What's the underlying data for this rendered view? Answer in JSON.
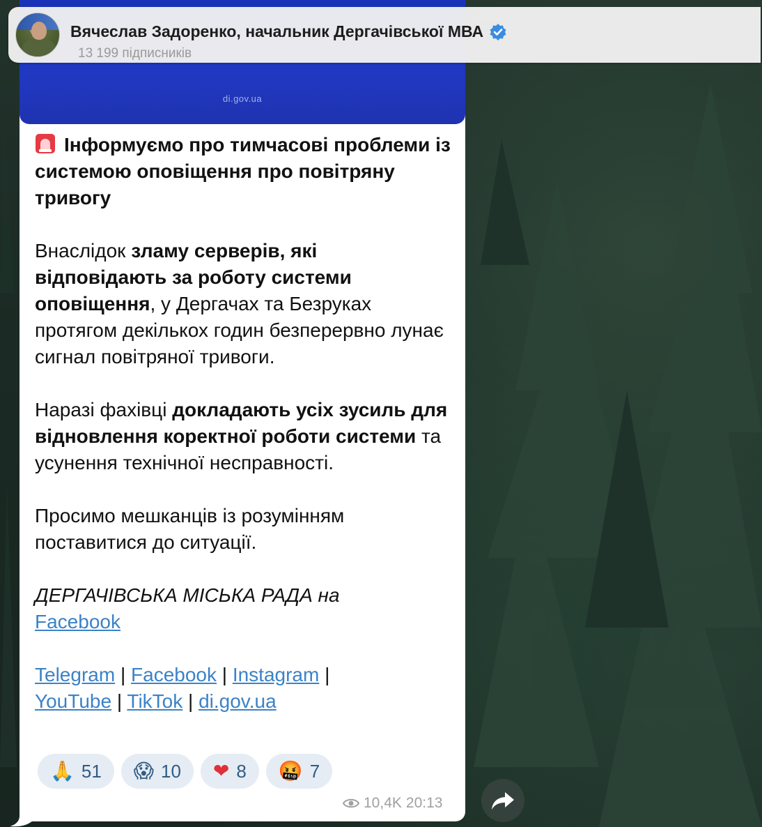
{
  "header": {
    "channel_name": "Вячеслав Задоренко, начальник Дергачівської МВА",
    "subscribers": "13 199 підписників",
    "verified_icon": "verified-badge-icon"
  },
  "media": {
    "site_label": "di.gov.ua"
  },
  "message": {
    "p1_bold": "Інформуємо про тимчасові проблеми із системою оповіщення про повітряну тривогу",
    "p2_a": "Внаслідок ",
    "p2_b": "зламу серверів, які відповідають за роботу системи оповіщення",
    "p2_c": ", у Дергачах та Безруках протягом декількох годин безперервно лунає сигнал повітряної тривоги.",
    "p3_a": "Наразі фахівці ",
    "p3_b": "докладають усіх зусиль для відновлення коректної роботи системи",
    "p3_c": " та усунення технічної несправності.",
    "p4": "Просимо мешканців із розумінням поставитися до ситуації.",
    "p5_italic": "ДЕРГАЧІВСЬКА МІСЬКА РАДА на",
    "p5_link": "Facebook",
    "links": [
      "Telegram",
      "Facebook",
      "Instagram",
      "YouTube",
      "TikTok",
      "di.gov.ua"
    ],
    "separator": "|"
  },
  "reactions": [
    {
      "emoji": "🙏",
      "count": "51"
    },
    {
      "emoji": "😱",
      "count": "10"
    },
    {
      "emoji": "❤",
      "count": "8"
    },
    {
      "emoji": "🤬",
      "count": "7"
    }
  ],
  "meta": {
    "views": "10,4K",
    "time": "20:13"
  },
  "colors": {
    "link": "#3b82c8",
    "reaction_bg": "#e6ecf3",
    "reaction_text": "#2f5c86",
    "media_blue": "#2038c2"
  }
}
